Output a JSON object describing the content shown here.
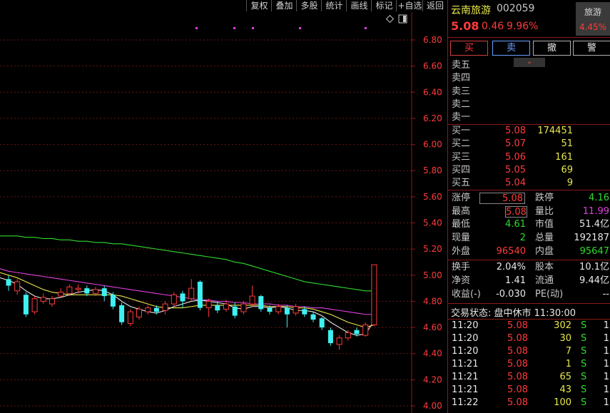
{
  "toolbar": {
    "buttons": [
      "复权",
      "叠加",
      "多股",
      "统计",
      "画线",
      "标记",
      "+自选",
      "返回"
    ]
  },
  "stock": {
    "name": "云南旅游",
    "code": "002059",
    "price": "5.08",
    "change": "0.46",
    "change_pct": "9.96%",
    "sector_name": "旅游",
    "sector_pct": "4.45%"
  },
  "trade_buttons": {
    "buy": "买",
    "sell": "卖",
    "cancel": "撤",
    "alert": "警"
  },
  "sell_levels": [
    {
      "label": "卖五",
      "price": "",
      "vol": ""
    },
    {
      "label": "卖四",
      "price": "",
      "vol": ""
    },
    {
      "label": "卖三",
      "price": "",
      "vol": ""
    },
    {
      "label": "卖二",
      "price": "",
      "vol": ""
    },
    {
      "label": "卖一",
      "price": "",
      "vol": ""
    }
  ],
  "buy_levels": [
    {
      "label": "买一",
      "price": "5.08",
      "vol": "174451"
    },
    {
      "label": "买二",
      "price": "5.07",
      "vol": "51"
    },
    {
      "label": "买三",
      "price": "5.06",
      "vol": "161"
    },
    {
      "label": "买四",
      "price": "5.05",
      "vol": "69"
    },
    {
      "label": "买五",
      "price": "5.04",
      "vol": "9"
    }
  ],
  "stats1": {
    "limit_up_label": "涨停",
    "limit_up": "5.08",
    "limit_down_label": "跌停",
    "limit_down": "4.16",
    "high_label": "最高",
    "high": "5.08",
    "vol_ratio_label": "量比",
    "vol_ratio": "11.99",
    "low_label": "最低",
    "low": "4.61",
    "mkt_cap_label": "市值",
    "mkt_cap": "51.4亿",
    "cur_vol_label": "现量",
    "cur_vol": "2",
    "total_vol_label": "总量",
    "total_vol": "192187",
    "outer_label": "外盘",
    "outer": "96540",
    "inner_label": "内盘",
    "inner": "95647"
  },
  "stats2": {
    "turnover_label": "换手",
    "turnover": "2.04%",
    "equity_label": "股本",
    "equity": "10.1亿",
    "nav_label": "净资",
    "nav": "1.41",
    "float_label": "流通",
    "float": "9.44亿",
    "eps_label": "收益(-)",
    "eps": "-0.030",
    "pe_label": "PE(动)",
    "pe": "--"
  },
  "trade_status": "交易状态: 盘中休市 11:30:00",
  "ticks": [
    {
      "time": "11:20",
      "price": "5.08",
      "vol": "302",
      "side": "S",
      "n": "1"
    },
    {
      "time": "11:20",
      "price": "5.08",
      "vol": "30",
      "side": "S",
      "n": "1"
    },
    {
      "time": "11:20",
      "price": "5.08",
      "vol": "7",
      "side": "S",
      "n": "1"
    },
    {
      "time": "11:21",
      "price": "5.08",
      "vol": "1",
      "side": "S",
      "n": "1"
    },
    {
      "time": "11:21",
      "price": "5.08",
      "vol": "65",
      "side": "S",
      "n": "1"
    },
    {
      "time": "11:21",
      "price": "5.08",
      "vol": "43",
      "side": "S",
      "n": "1"
    },
    {
      "time": "11:22",
      "price": "5.08",
      "vol": "100",
      "side": "S",
      "n": "1"
    }
  ],
  "chart_data": {
    "type": "candlestick",
    "yaxis_ticks": [
      "6.80",
      "6.60",
      "6.40",
      "6.20",
      "6.00",
      "5.80",
      "5.60",
      "5.40",
      "5.20",
      "5.00",
      "4.80",
      "4.60",
      "4.40",
      "4.20",
      "4.00"
    ],
    "ylim": [
      4.0,
      6.8
    ],
    "candles": [
      {
        "o": 4.97,
        "c": 4.92,
        "h": 5.0,
        "l": 4.88
      },
      {
        "o": 4.88,
        "c": 4.95,
        "h": 4.97,
        "l": 4.85
      },
      {
        "o": 4.85,
        "c": 4.7,
        "h": 4.87,
        "l": 4.68
      },
      {
        "o": 4.72,
        "c": 4.82,
        "h": 4.84,
        "l": 4.7
      },
      {
        "o": 4.8,
        "c": 4.83,
        "h": 4.86,
        "l": 4.78
      },
      {
        "o": 4.78,
        "c": 4.82,
        "h": 4.84,
        "l": 4.76
      },
      {
        "o": 4.84,
        "c": 4.87,
        "h": 4.9,
        "l": 4.83
      },
      {
        "o": 4.86,
        "c": 4.91,
        "h": 4.93,
        "l": 4.84
      },
      {
        "o": 4.89,
        "c": 4.9,
        "h": 4.93,
        "l": 4.86
      },
      {
        "o": 4.9,
        "c": 4.86,
        "h": 4.92,
        "l": 4.84
      },
      {
        "o": 4.86,
        "c": 4.89,
        "h": 4.91,
        "l": 4.84
      },
      {
        "o": 4.9,
        "c": 4.84,
        "h": 4.92,
        "l": 4.8
      },
      {
        "o": 4.85,
        "c": 4.76,
        "h": 4.87,
        "l": 4.74
      },
      {
        "o": 4.77,
        "c": 4.64,
        "h": 4.79,
        "l": 4.62
      },
      {
        "o": 4.63,
        "c": 4.72,
        "h": 4.74,
        "l": 4.61
      },
      {
        "o": 4.68,
        "c": 4.74,
        "h": 4.76,
        "l": 4.66
      },
      {
        "o": 4.72,
        "c": 4.75,
        "h": 4.77,
        "l": 4.7
      },
      {
        "o": 4.75,
        "c": 4.72,
        "h": 4.77,
        "l": 4.7
      },
      {
        "o": 4.73,
        "c": 4.78,
        "h": 4.8,
        "l": 4.7
      },
      {
        "o": 4.78,
        "c": 4.85,
        "h": 4.87,
        "l": 4.76
      },
      {
        "o": 4.86,
        "c": 4.8,
        "h": 4.88,
        "l": 4.75
      },
      {
        "o": 4.82,
        "c": 4.9,
        "h": 4.97,
        "l": 4.8
      },
      {
        "o": 4.95,
        "c": 4.75,
        "h": 4.96,
        "l": 4.73
      },
      {
        "o": 4.75,
        "c": 4.8,
        "h": 4.82,
        "l": 4.68
      },
      {
        "o": 4.77,
        "c": 4.73,
        "h": 4.8,
        "l": 4.71
      },
      {
        "o": 4.74,
        "c": 4.78,
        "h": 4.81,
        "l": 4.72
      },
      {
        "o": 4.76,
        "c": 4.69,
        "h": 4.79,
        "l": 4.67
      },
      {
        "o": 4.72,
        "c": 4.78,
        "h": 4.8,
        "l": 4.7
      },
      {
        "o": 4.78,
        "c": 4.84,
        "h": 4.92,
        "l": 4.76
      },
      {
        "o": 4.84,
        "c": 4.74,
        "h": 4.85,
        "l": 4.72
      },
      {
        "o": 4.75,
        "c": 4.72,
        "h": 4.77,
        "l": 4.7
      },
      {
        "o": 4.72,
        "c": 4.76,
        "h": 4.78,
        "l": 4.7
      },
      {
        "o": 4.75,
        "c": 4.7,
        "h": 4.77,
        "l": 4.6
      },
      {
        "o": 4.71,
        "c": 4.76,
        "h": 4.78,
        "l": 4.69
      },
      {
        "o": 4.74,
        "c": 4.7,
        "h": 4.76,
        "l": 4.68
      },
      {
        "o": 4.7,
        "c": 4.66,
        "h": 4.72,
        "l": 4.64
      },
      {
        "o": 4.67,
        "c": 4.6,
        "h": 4.68,
        "l": 4.58
      },
      {
        "o": 4.58,
        "c": 4.48,
        "h": 4.6,
        "l": 4.46
      },
      {
        "o": 4.47,
        "c": 4.52,
        "h": 4.54,
        "l": 4.43
      },
      {
        "o": 4.52,
        "c": 4.56,
        "h": 4.58,
        "l": 4.5
      },
      {
        "o": 4.58,
        "c": 4.55,
        "h": 4.6,
        "l": 4.53
      },
      {
        "o": 4.54,
        "c": 4.62,
        "h": 4.64,
        "l": 4.53
      },
      {
        "o": 4.62,
        "c": 5.08,
        "h": 5.08,
        "l": 4.61
      }
    ],
    "ma5": [
      4.96,
      4.93,
      4.88,
      4.84,
      4.82,
      4.82,
      4.83,
      4.85,
      4.87,
      4.88,
      4.89,
      4.88,
      4.85,
      4.8,
      4.76,
      4.74,
      4.72,
      4.71,
      4.73,
      4.76,
      4.78,
      4.8,
      4.81,
      4.8,
      4.79,
      4.78,
      4.75,
      4.74,
      4.76,
      4.76,
      4.75,
      4.76,
      4.75,
      4.73,
      4.73,
      4.72,
      4.69,
      4.64,
      4.6,
      4.56,
      4.54,
      4.55,
      4.65
    ],
    "ma10": [
      5.0,
      4.98,
      4.95,
      4.92,
      4.89,
      4.87,
      4.86,
      4.85,
      4.85,
      4.85,
      4.85,
      4.85,
      4.85,
      4.84,
      4.82,
      4.8,
      4.78,
      4.76,
      4.75,
      4.75,
      4.75,
      4.76,
      4.77,
      4.77,
      4.77,
      4.77,
      4.77,
      4.77,
      4.77,
      4.77,
      4.76,
      4.76,
      4.76,
      4.75,
      4.75,
      4.74,
      4.72,
      4.7,
      4.67,
      4.64,
      4.62,
      4.6,
      4.62
    ],
    "ma30": [
      5.03,
      5.02,
      5.01,
      5.0,
      4.99,
      4.98,
      4.97,
      4.96,
      4.95,
      4.94,
      4.93,
      4.92,
      4.91,
      4.9,
      4.89,
      4.88,
      4.87,
      4.86,
      4.85,
      4.84,
      4.83,
      4.82,
      4.81,
      4.81,
      4.8,
      4.8,
      4.79,
      4.79,
      4.78,
      4.78,
      4.78,
      4.77,
      4.77,
      4.76,
      4.76,
      4.75,
      4.75,
      4.74,
      4.73,
      4.72,
      4.71,
      4.7,
      4.7
    ],
    "ma60": [
      5.3,
      5.3,
      5.29,
      5.29,
      5.28,
      5.28,
      5.27,
      5.27,
      5.26,
      5.26,
      5.25,
      5.25,
      5.24,
      5.24,
      5.23,
      5.22,
      5.21,
      5.2,
      5.19,
      5.18,
      5.17,
      5.16,
      5.15,
      5.14,
      5.13,
      5.12,
      5.1,
      5.09,
      5.07,
      5.05,
      5.03,
      5.01,
      4.99,
      4.97,
      4.95,
      4.94,
      4.93,
      4.92,
      4.91,
      4.9,
      4.89,
      4.88,
      4.88
    ]
  },
  "colors": {
    "up": "#ff3b3b",
    "down": "#3ff0f0",
    "ma5": "#e8e8e8",
    "ma10": "#e8e84a",
    "ma30": "#e040e0",
    "ma60": "#2fdc2f",
    "frame": "#8b1a1a"
  }
}
